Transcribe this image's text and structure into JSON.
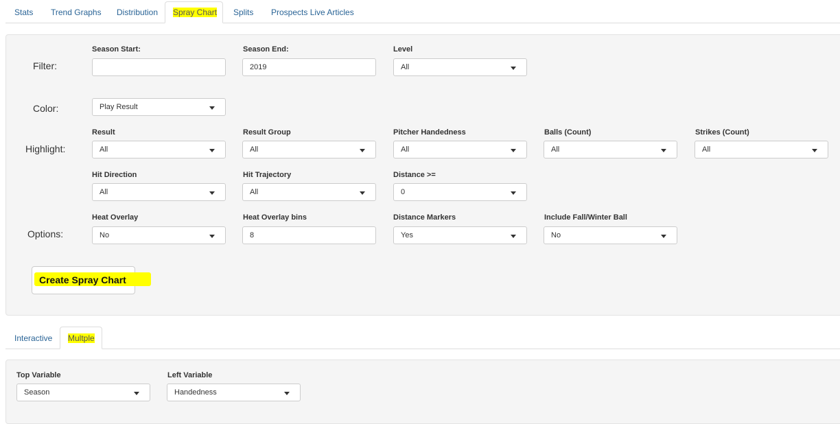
{
  "top_tabs": {
    "items": [
      "Stats",
      "Trend Graphs",
      "Distribution",
      "Spray Chart",
      "Splits",
      "Prospects Live Articles"
    ],
    "active": "Spray Chart"
  },
  "filter": {
    "row_label": "Filter:",
    "season_start": {
      "label": "Season Start:",
      "value": ""
    },
    "season_end": {
      "label": "Season End:",
      "value": "2019"
    },
    "level": {
      "label": "Level",
      "value": "All"
    }
  },
  "color": {
    "row_label": "Color:",
    "value": "Play Result"
  },
  "highlight": {
    "row_label": "Highlight:",
    "result": {
      "label": "Result",
      "value": "All"
    },
    "result_group": {
      "label": "Result Group",
      "value": "All"
    },
    "pitcher_handedness": {
      "label": "Pitcher Handedness",
      "value": "All"
    },
    "balls": {
      "label": "Balls (Count)",
      "value": "All"
    },
    "strikes": {
      "label": "Strikes (Count)",
      "value": "All"
    },
    "hit_direction": {
      "label": "Hit Direction",
      "value": "All"
    },
    "hit_trajectory": {
      "label": "Hit Trajectory",
      "value": "All"
    },
    "distance": {
      "label": "Distance >=",
      "value": "0"
    }
  },
  "options": {
    "row_label": "Options:",
    "heat_overlay": {
      "label": "Heat Overlay",
      "value": "No"
    },
    "heat_overlay_bins": {
      "label": "Heat Overlay bins",
      "value": "8"
    },
    "distance_markers": {
      "label": "Distance Markers",
      "value": "Yes"
    },
    "include_fall_winter": {
      "label": "Include Fall/Winter Ball",
      "value": "No"
    }
  },
  "create_button": {
    "label": "Create Spray Chart"
  },
  "sub_tabs": {
    "items": [
      "Interactive",
      "Multple"
    ],
    "active": "Multple"
  },
  "multiple": {
    "top_variable": {
      "label": "Top Variable",
      "value": "Season"
    },
    "left_variable": {
      "label": "Left Variable",
      "value": "Handedness"
    }
  },
  "colors": {
    "highlight": "#ffff00",
    "link": "#2a6496",
    "panel_bg": "#f5f5f5"
  }
}
